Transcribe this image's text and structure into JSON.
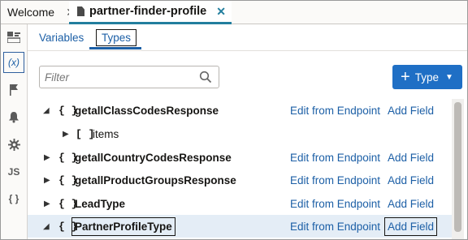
{
  "tabs": [
    {
      "label": "Welcome"
    },
    {
      "label": "partner-finder-profile"
    }
  ],
  "subtabs": {
    "variables": "Variables",
    "types": "Types"
  },
  "sidebar": {
    "js_label": "JS",
    "braces_label": "{ }",
    "variables_label": "(x)"
  },
  "filter": {
    "placeholder": "Filter"
  },
  "type_button": {
    "label": "Type"
  },
  "rows": [
    {
      "symbol": "{ }",
      "name": "getallClassCodesResponse",
      "expanded": true,
      "edit": "Edit from Endpoint",
      "add": "Add Field"
    },
    {
      "symbol": "[ ]",
      "name": "items",
      "child": true
    },
    {
      "symbol": "{ }",
      "name": "getallCountryCodesResponse",
      "expanded": false,
      "edit": "Edit from Endpoint",
      "add": "Add Field"
    },
    {
      "symbol": "{ }",
      "name": "getallProductGroupsResponse",
      "expanded": false,
      "edit": "Edit from Endpoint",
      "add": "Add Field"
    },
    {
      "symbol": "{ }",
      "name": "LeadType",
      "expanded": false,
      "edit": "Edit from Endpoint",
      "add": "Add Field"
    },
    {
      "symbol": "{ }",
      "name": "PartnerProfileType",
      "expanded": true,
      "selected": true,
      "edit": "Edit from Endpoint",
      "add": "Add Field"
    }
  ],
  "colors": {
    "accent": "#1c5fa6",
    "button": "#1f6fc5",
    "tab_underline": "#227e9e",
    "selected_row": "#e4edf6"
  }
}
